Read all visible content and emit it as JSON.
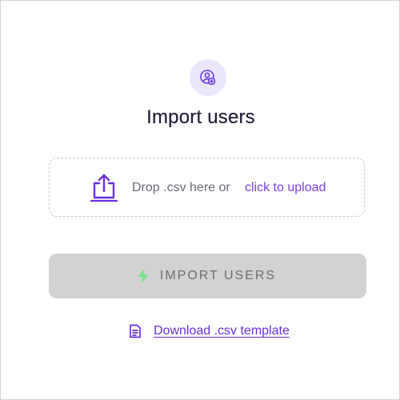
{
  "dialog": {
    "title": "Import users",
    "header_icon": "user-add-icon"
  },
  "dropzone": {
    "icon": "upload-icon",
    "text": "Drop .csv here or",
    "link_label": "click to upload"
  },
  "import_button": {
    "icon": "bolt-icon",
    "label": "IMPORT USERS",
    "state": "disabled"
  },
  "download": {
    "icon": "document-icon",
    "label": "Download .csv template"
  },
  "colors": {
    "accent": "#7b3fe4",
    "accent_light": "#ece6fb",
    "bolt": "#6ee787",
    "button_disabled_bg": "#d2d2d2",
    "title": "#23233a"
  }
}
